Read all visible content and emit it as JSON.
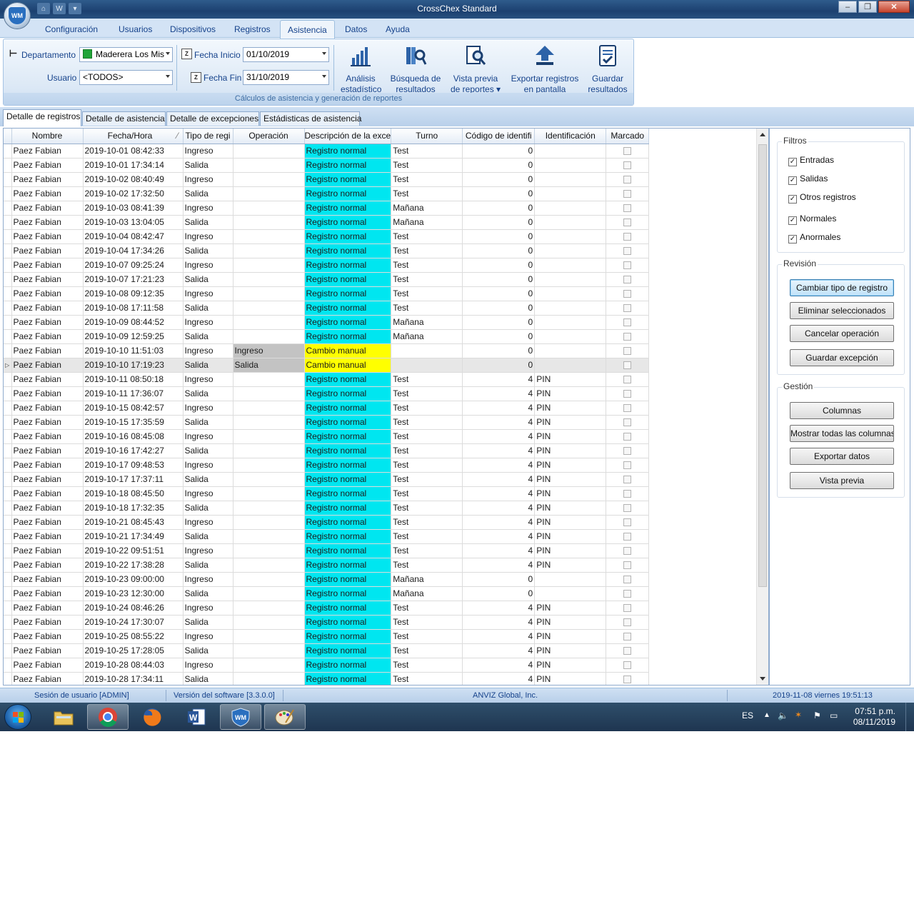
{
  "window": {
    "title": "CrossChex Standard",
    "orb_text": "WM"
  },
  "menu": {
    "tabs": [
      "Configuración",
      "Usuarios",
      "Dispositivos",
      "Registros",
      "Asistencia",
      "Datos",
      "Ayuda"
    ],
    "active": "Asistencia"
  },
  "ribbon": {
    "departamento_label": "Departamento",
    "departamento_value": "Maderera Los Mis",
    "usuario_label": "Usuario",
    "usuario_value": "<TODOS>",
    "fecha_inicio_label": "Fecha Inicio",
    "fecha_inicio_value": "01/10/2019",
    "fecha_fin_label": "Fecha Fin",
    "fecha_fin_value": "31/10/2019",
    "buttons": [
      {
        "line1": "Análisis",
        "line2": "estadístico",
        "icon": "bar-chart-icon"
      },
      {
        "line1": "Búsqueda de",
        "line2": "resultados",
        "icon": "search-binders-icon"
      },
      {
        "line1": "Vista previa",
        "line2": "de reportes ▾",
        "icon": "preview-magnifier-icon"
      },
      {
        "line1": "Exportar registros",
        "line2": "en pantalla",
        "icon": "export-arrow-icon"
      },
      {
        "line1": "Guardar",
        "line2": "resultados",
        "icon": "save-document-icon"
      }
    ],
    "caption": "Cálculos de asistencia y generación de reportes"
  },
  "subtabs": [
    "Detalle de registros",
    "Detalle de asistencia",
    "Detalle de excepciones",
    "Estádisticas de asistencia"
  ],
  "grid": {
    "headers": [
      "Nombre",
      "Fecha/Hora",
      "Tipo de regi",
      "Operación",
      "Descripción de la exce",
      "Turno",
      "Código de identifi",
      "Identificación",
      "Marcado"
    ],
    "rows": [
      [
        "Paez Fabian",
        "2019-10-01 08:42:33",
        "Ingreso",
        "",
        "Registro normal",
        "Test",
        "0",
        ""
      ],
      [
        "Paez Fabian",
        "2019-10-01 17:34:14",
        "Salida",
        "",
        "Registro normal",
        "Test",
        "0",
        ""
      ],
      [
        "Paez Fabian",
        "2019-10-02 08:40:49",
        "Ingreso",
        "",
        "Registro normal",
        "Test",
        "0",
        ""
      ],
      [
        "Paez Fabian",
        "2019-10-02 17:32:50",
        "Salida",
        "",
        "Registro normal",
        "Test",
        "0",
        ""
      ],
      [
        "Paez Fabian",
        "2019-10-03 08:41:39",
        "Ingreso",
        "",
        "Registro normal",
        "Mañana",
        "0",
        ""
      ],
      [
        "Paez Fabian",
        "2019-10-03 13:04:05",
        "Salida",
        "",
        "Registro normal",
        "Mañana",
        "0",
        ""
      ],
      [
        "Paez Fabian",
        "2019-10-04 08:42:47",
        "Ingreso",
        "",
        "Registro normal",
        "Test",
        "0",
        ""
      ],
      [
        "Paez Fabian",
        "2019-10-04 17:34:26",
        "Salida",
        "",
        "Registro normal",
        "Test",
        "0",
        ""
      ],
      [
        "Paez Fabian",
        "2019-10-07 09:25:24",
        "Ingreso",
        "",
        "Registro normal",
        "Test",
        "0",
        ""
      ],
      [
        "Paez Fabian",
        "2019-10-07 17:21:23",
        "Salida",
        "",
        "Registro normal",
        "Test",
        "0",
        ""
      ],
      [
        "Paez Fabian",
        "2019-10-08 09:12:35",
        "Ingreso",
        "",
        "Registro normal",
        "Test",
        "0",
        ""
      ],
      [
        "Paez Fabian",
        "2019-10-08 17:11:58",
        "Salida",
        "",
        "Registro normal",
        "Test",
        "0",
        ""
      ],
      [
        "Paez Fabian",
        "2019-10-09 08:44:52",
        "Ingreso",
        "",
        "Registro normal",
        "Mañana",
        "0",
        ""
      ],
      [
        "Paez Fabian",
        "2019-10-09 12:59:25",
        "Salida",
        "",
        "Registro normal",
        "Mañana",
        "0",
        ""
      ],
      [
        "Paez Fabian",
        "2019-10-10 11:51:03",
        "Ingreso",
        "Ingreso",
        "Cambio manual",
        "",
        "0",
        ""
      ],
      [
        "Paez Fabian",
        "2019-10-10 17:19:23",
        "Salida",
        "Salida",
        "Cambio manual",
        "",
        "0",
        ""
      ],
      [
        "Paez Fabian",
        "2019-10-11 08:50:18",
        "Ingreso",
        "",
        "Registro normal",
        "Test",
        "4",
        "PIN"
      ],
      [
        "Paez Fabian",
        "2019-10-11 17:36:07",
        "Salida",
        "",
        "Registro normal",
        "Test",
        "4",
        "PIN"
      ],
      [
        "Paez Fabian",
        "2019-10-15 08:42:57",
        "Ingreso",
        "",
        "Registro normal",
        "Test",
        "4",
        "PIN"
      ],
      [
        "Paez Fabian",
        "2019-10-15 17:35:59",
        "Salida",
        "",
        "Registro normal",
        "Test",
        "4",
        "PIN"
      ],
      [
        "Paez Fabian",
        "2019-10-16 08:45:08",
        "Ingreso",
        "",
        "Registro normal",
        "Test",
        "4",
        "PIN"
      ],
      [
        "Paez Fabian",
        "2019-10-16 17:42:27",
        "Salida",
        "",
        "Registro normal",
        "Test",
        "4",
        "PIN"
      ],
      [
        "Paez Fabian",
        "2019-10-17 09:48:53",
        "Ingreso",
        "",
        "Registro normal",
        "Test",
        "4",
        "PIN"
      ],
      [
        "Paez Fabian",
        "2019-10-17 17:37:11",
        "Salida",
        "",
        "Registro normal",
        "Test",
        "4",
        "PIN"
      ],
      [
        "Paez Fabian",
        "2019-10-18 08:45:50",
        "Ingreso",
        "",
        "Registro normal",
        "Test",
        "4",
        "PIN"
      ],
      [
        "Paez Fabian",
        "2019-10-18 17:32:35",
        "Salida",
        "",
        "Registro normal",
        "Test",
        "4",
        "PIN"
      ],
      [
        "Paez Fabian",
        "2019-10-21 08:45:43",
        "Ingreso",
        "",
        "Registro normal",
        "Test",
        "4",
        "PIN"
      ],
      [
        "Paez Fabian",
        "2019-10-21 17:34:49",
        "Salida",
        "",
        "Registro normal",
        "Test",
        "4",
        "PIN"
      ],
      [
        "Paez Fabian",
        "2019-10-22 09:51:51",
        "Ingreso",
        "",
        "Registro normal",
        "Test",
        "4",
        "PIN"
      ],
      [
        "Paez Fabian",
        "2019-10-22 17:38:28",
        "Salida",
        "",
        "Registro normal",
        "Test",
        "4",
        "PIN"
      ],
      [
        "Paez Fabian",
        "2019-10-23 09:00:00",
        "Ingreso",
        "",
        "Registro normal",
        "Mañana",
        "0",
        ""
      ],
      [
        "Paez Fabian",
        "2019-10-23 12:30:00",
        "Salida",
        "",
        "Registro normal",
        "Mañana",
        "0",
        ""
      ],
      [
        "Paez Fabian",
        "2019-10-24 08:46:26",
        "Ingreso",
        "",
        "Registro normal",
        "Test",
        "4",
        "PIN"
      ],
      [
        "Paez Fabian",
        "2019-10-24 17:30:07",
        "Salida",
        "",
        "Registro normal",
        "Test",
        "4",
        "PIN"
      ],
      [
        "Paez Fabian",
        "2019-10-25 08:55:22",
        "Ingreso",
        "",
        "Registro normal",
        "Test",
        "4",
        "PIN"
      ],
      [
        "Paez Fabian",
        "2019-10-25 17:28:05",
        "Salida",
        "",
        "Registro normal",
        "Test",
        "4",
        "PIN"
      ],
      [
        "Paez Fabian",
        "2019-10-28 08:44:03",
        "Ingreso",
        "",
        "Registro normal",
        "Test",
        "4",
        "PIN"
      ],
      [
        "Paez Fabian",
        "2019-10-28 17:34:11",
        "Salida",
        "",
        "Registro normal",
        "Test",
        "4",
        "PIN"
      ]
    ],
    "current_row_index": 15,
    "colors": {
      "normal": "#00e6f0",
      "manual": "#ffff00",
      "operation": "#c3c3c3"
    }
  },
  "filters": {
    "title": "Filtros",
    "items": [
      {
        "label": "Entradas",
        "checked": true
      },
      {
        "label": "Salidas",
        "checked": true
      },
      {
        "label": "Otros registros",
        "checked": true
      },
      {
        "label": "Normales",
        "checked": true
      },
      {
        "label": "Anormales",
        "checked": true
      }
    ]
  },
  "revision": {
    "title": "Revisión",
    "buttons": [
      "Cambiar tipo de registro",
      "Eliminar seleccionados",
      "Cancelar operación",
      "Guardar excepción"
    ]
  },
  "gestion": {
    "title": "Gestión",
    "buttons": [
      "Columnas",
      "Mostrar todas las columnas",
      "Exportar datos",
      "Vista previa"
    ]
  },
  "status": {
    "session": "Sesión de usuario  [ADMIN]",
    "version": "Versión del software  [3.3.0.0]",
    "company": "ANVIZ Global, Inc.",
    "datetime": "2019-11-08 viernes 19:51:13"
  },
  "taskbar": {
    "lang": "ES",
    "time": "07:51 p.m.",
    "date": "08/11/2019"
  }
}
